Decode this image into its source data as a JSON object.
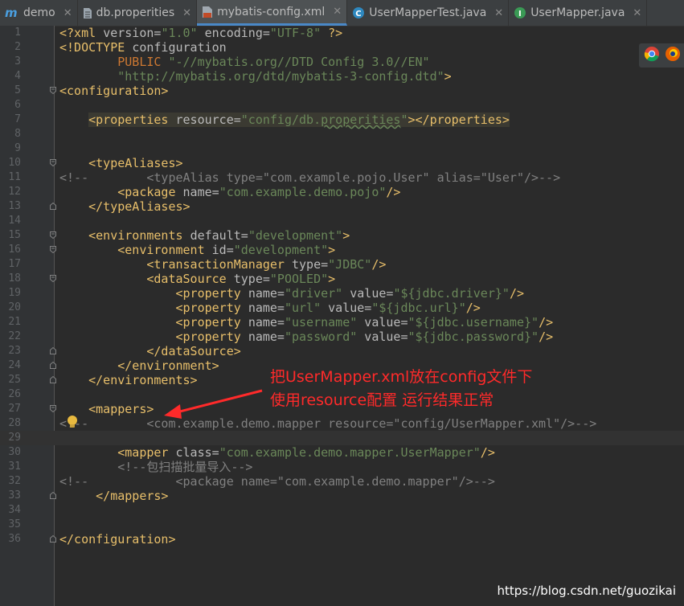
{
  "tabs": [
    {
      "label": "demo",
      "icon": "module-m-icon",
      "active": false
    },
    {
      "label": "db.properities",
      "icon": "properties-file-icon",
      "active": false
    },
    {
      "label": "mybatis-config.xml",
      "icon": "xml-file-icon",
      "active": true
    },
    {
      "label": "UserMapperTest.java",
      "icon": "java-class-icon",
      "active": false
    },
    {
      "label": "UserMapper.java",
      "icon": "java-interface-icon",
      "active": false
    }
  ],
  "editor": {
    "caret_line": 29,
    "lines": [
      {
        "n": "1",
        "fold": "",
        "tokens": [
          [
            "t",
            "<?xml "
          ],
          [
            "a",
            "version="
          ],
          [
            "v",
            "\"1.0\""
          ],
          [
            "a",
            " encoding="
          ],
          [
            "v",
            "\"UTF-8\""
          ],
          [
            "t",
            " ?>"
          ]
        ]
      },
      {
        "n": "2",
        "fold": "",
        "tokens": [
          [
            "t",
            "<!DOCTYPE "
          ],
          [
            "a",
            "configuration"
          ]
        ]
      },
      {
        "n": "3",
        "fold": "",
        "tokens": [
          [
            "p",
            "        PUBLIC "
          ],
          [
            "v",
            "\"-//mybatis.org//DTD Config 3.0//EN\""
          ]
        ]
      },
      {
        "n": "4",
        "fold": "",
        "tokens": [
          [
            "v",
            "        \"http://mybatis.org/dtd/mybatis-3-config.dtd\""
          ],
          [
            "t",
            ">"
          ]
        ]
      },
      {
        "n": "5",
        "fold": "open",
        "tokens": [
          [
            "t",
            "<configuration>"
          ]
        ]
      },
      {
        "n": "6",
        "fold": "",
        "tokens": []
      },
      {
        "n": "7",
        "fold": "",
        "tokens": [
          [
            "a",
            "    "
          ],
          [
            "t hl",
            "<properties "
          ],
          [
            "a hl",
            "resource="
          ],
          [
            "v hl",
            "\"config/db."
          ],
          [
            "v hl wav",
            "properities"
          ],
          [
            "v hl",
            "\""
          ],
          [
            "t hl",
            "></properties>"
          ]
        ]
      },
      {
        "n": "8",
        "fold": "",
        "tokens": []
      },
      {
        "n": "9",
        "fold": "",
        "tokens": []
      },
      {
        "n": "10",
        "fold": "open",
        "tokens": [
          [
            "t",
            "    <typeAliases>"
          ]
        ]
      },
      {
        "n": "11",
        "fold": "",
        "tokens": [
          [
            "c",
            "<!--        <typeAlias type=\"com.example.pojo.User\" alias=\"User\"/>-->"
          ]
        ]
      },
      {
        "n": "12",
        "fold": "",
        "tokens": [
          [
            "t",
            "        <package "
          ],
          [
            "a",
            "name="
          ],
          [
            "v",
            "\"com.example.demo.pojo\""
          ],
          [
            "t",
            "/>"
          ]
        ]
      },
      {
        "n": "13",
        "fold": "close",
        "tokens": [
          [
            "t",
            "    </typeAliases>"
          ]
        ]
      },
      {
        "n": "14",
        "fold": "",
        "tokens": []
      },
      {
        "n": "15",
        "fold": "open",
        "tokens": [
          [
            "t",
            "    <environments "
          ],
          [
            "a",
            "default="
          ],
          [
            "v",
            "\"development\""
          ],
          [
            "t",
            ">"
          ]
        ]
      },
      {
        "n": "16",
        "fold": "open",
        "tokens": [
          [
            "t",
            "        <environment "
          ],
          [
            "a",
            "id="
          ],
          [
            "v",
            "\"development\""
          ],
          [
            "t",
            ">"
          ]
        ]
      },
      {
        "n": "17",
        "fold": "",
        "tokens": [
          [
            "t",
            "            <transactionManager "
          ],
          [
            "a",
            "type="
          ],
          [
            "v",
            "\"JDBC\""
          ],
          [
            "t",
            "/>"
          ]
        ]
      },
      {
        "n": "18",
        "fold": "open",
        "tokens": [
          [
            "t",
            "            <dataSource "
          ],
          [
            "a",
            "type="
          ],
          [
            "v",
            "\"POOLED\""
          ],
          [
            "t",
            ">"
          ]
        ]
      },
      {
        "n": "19",
        "fold": "",
        "tokens": [
          [
            "t",
            "                <property "
          ],
          [
            "a",
            "name="
          ],
          [
            "v",
            "\"driver\""
          ],
          [
            "a",
            " value="
          ],
          [
            "v",
            "\"${jdbc.driver}\""
          ],
          [
            "t",
            "/>"
          ]
        ]
      },
      {
        "n": "20",
        "fold": "",
        "tokens": [
          [
            "t",
            "                <property "
          ],
          [
            "a",
            "name="
          ],
          [
            "v",
            "\"url\""
          ],
          [
            "a",
            " value="
          ],
          [
            "v",
            "\"${jdbc.url}\""
          ],
          [
            "t",
            "/>"
          ]
        ]
      },
      {
        "n": "21",
        "fold": "",
        "tokens": [
          [
            "t",
            "                <property "
          ],
          [
            "a",
            "name="
          ],
          [
            "v",
            "\"username\""
          ],
          [
            "a",
            " value="
          ],
          [
            "v",
            "\"${jdbc.username}\""
          ],
          [
            "t",
            "/>"
          ]
        ]
      },
      {
        "n": "22",
        "fold": "",
        "tokens": [
          [
            "t",
            "                <property "
          ],
          [
            "a",
            "name="
          ],
          [
            "v",
            "\"password\""
          ],
          [
            "a",
            " value="
          ],
          [
            "v",
            "\"${jdbc.password}\""
          ],
          [
            "t",
            "/>"
          ]
        ]
      },
      {
        "n": "23",
        "fold": "close",
        "tokens": [
          [
            "t",
            "            </dataSource>"
          ]
        ]
      },
      {
        "n": "24",
        "fold": "close",
        "tokens": [
          [
            "t",
            "        </environment>"
          ]
        ]
      },
      {
        "n": "25",
        "fold": "close",
        "tokens": [
          [
            "t",
            "    </environments>"
          ]
        ]
      },
      {
        "n": "26",
        "fold": "",
        "tokens": []
      },
      {
        "n": "27",
        "fold": "open",
        "tokens": [
          [
            "t",
            "    <mappers>"
          ]
        ]
      },
      {
        "n": "28",
        "fold": "",
        "tokens": [
          [
            "c",
            "<!--        <com.example.demo.mapper resource=\"config/UserMapper.xml\"/>-->"
          ]
        ]
      },
      {
        "n": "29",
        "fold": "",
        "tokens": []
      },
      {
        "n": "30",
        "fold": "",
        "tokens": [
          [
            "t",
            "        <mapper "
          ],
          [
            "a",
            "class="
          ],
          [
            "v",
            "\"com.example.demo.mapper.UserMapper\""
          ],
          [
            "t",
            "/>"
          ]
        ]
      },
      {
        "n": "31",
        "fold": "",
        "tokens": [
          [
            "c",
            "        <!--包扫描批量导入-->"
          ]
        ]
      },
      {
        "n": "32",
        "fold": "",
        "tokens": [
          [
            "c",
            "<!--            <package name=\"com.example.demo.mapper\"/>-->"
          ]
        ]
      },
      {
        "n": "33",
        "fold": "close",
        "tokens": [
          [
            "t",
            "     </mappers>"
          ]
        ]
      },
      {
        "n": "34",
        "fold": "",
        "tokens": []
      },
      {
        "n": "35",
        "fold": "",
        "tokens": []
      },
      {
        "n": "36",
        "fold": "close",
        "tokens": [
          [
            "t",
            "</configuration>"
          ]
        ]
      }
    ]
  },
  "annotation": {
    "text": "把UserMapper.xml放在config文件下\n使用resource配置 运行结果正常",
    "color": "#ff2a2a"
  },
  "browser_icons": [
    "chrome-icon",
    "firefox-icon"
  ],
  "watermark": "https://blog.csdn.net/guozikai",
  "colors": {
    "background": "#2b2b2b",
    "tag": "#e8bf6a",
    "attribute": "#bababa",
    "value": "#6a8759",
    "comment": "#808080",
    "keyword": "#cc7832"
  }
}
